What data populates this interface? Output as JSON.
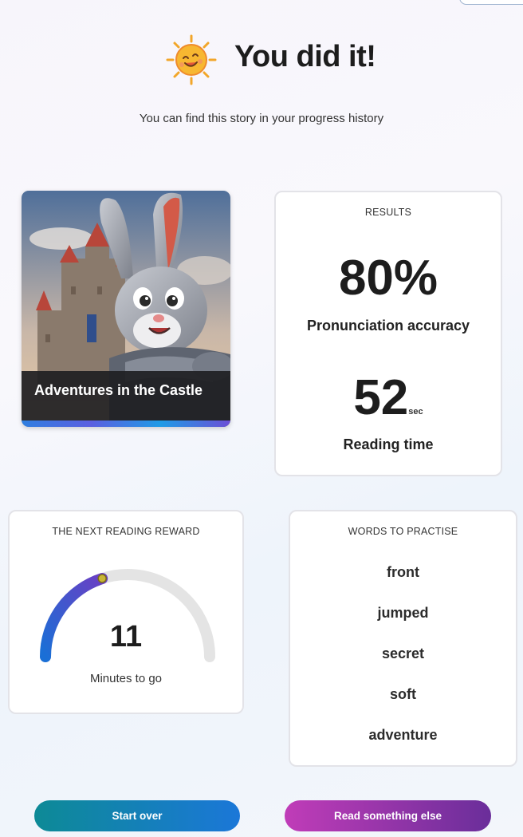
{
  "header": {
    "title": "You did it!",
    "subtitle": "You can find this story in your progress history"
  },
  "story": {
    "title": "Adventures in the Castle",
    "image": "bunny-knight-castle-illustration"
  },
  "results": {
    "label": "RESULTS",
    "accuracy_value": "80%",
    "accuracy_label": "Pronunciation accuracy",
    "time_value": "52",
    "time_unit": "sec",
    "time_label": "Reading time"
  },
  "reward": {
    "label": "THE NEXT READING REWARD",
    "progress_fraction": 0.4,
    "value": "11",
    "caption": "Minutes to go"
  },
  "practice": {
    "label": "WORDS TO PRACTISE",
    "words": [
      "front",
      "jumped",
      "secret",
      "soft",
      "adventure"
    ]
  },
  "buttons": {
    "start_over": "Start over",
    "read_else": "Read something else"
  },
  "colors": {
    "start_gradient": [
      "#0d8a96",
      "#1b77d8"
    ],
    "read_gradient": [
      "#c03cb8",
      "#6a2e9a"
    ],
    "gauge_progress": [
      "#1a6fd6",
      "#6a3fc4"
    ],
    "gauge_track": "#e4e4e4",
    "gauge_knob": "#c9b634"
  }
}
